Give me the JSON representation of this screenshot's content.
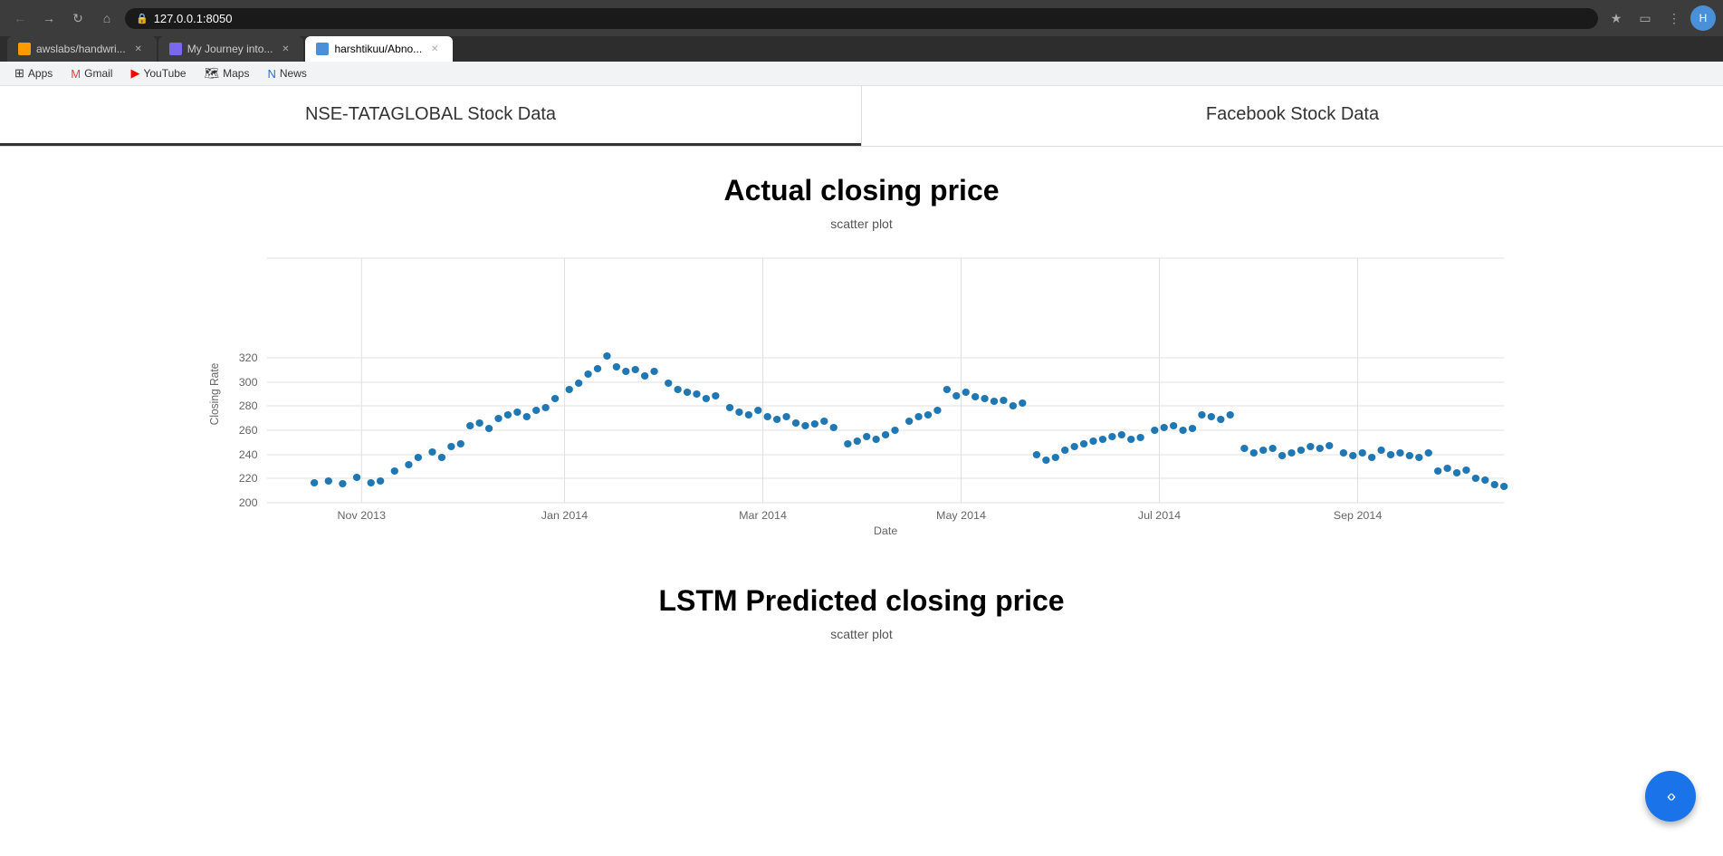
{
  "browser": {
    "url": "127.0.0.1:8050",
    "back_disabled": false,
    "forward_disabled": false
  },
  "tabs": [
    {
      "id": "awslabs",
      "title": "awslabs/handwri...",
      "favicon_color": "#ff9900",
      "active": false
    },
    {
      "id": "myjourney",
      "title": "My Journey into...",
      "favicon_color": "#7b68ee",
      "active": false
    },
    {
      "id": "harshtikuu",
      "title": "harshtikuu/Abno...",
      "favicon_color": "#4a90d9",
      "active": true
    }
  ],
  "bookmarks": [
    {
      "id": "apps",
      "label": "Apps",
      "favicon": "grid"
    },
    {
      "id": "gmail",
      "label": "Gmail",
      "favicon": "gmail"
    },
    {
      "id": "youtube",
      "label": "YouTube",
      "favicon": "youtube"
    },
    {
      "id": "maps",
      "label": "Maps",
      "favicon": "maps"
    },
    {
      "id": "news",
      "label": "News",
      "favicon": "news"
    }
  ],
  "page": {
    "nav_items": [
      {
        "id": "nse",
        "label": "NSE-TATAGLOBAL Stock Data",
        "active": true
      },
      {
        "id": "facebook",
        "label": "Facebook Stock Data",
        "active": false
      }
    ],
    "actual_chart": {
      "title": "Actual closing price",
      "subtitle": "scatter plot",
      "y_axis_label": "Closing Rate",
      "x_axis_label": "Date",
      "y_ticks": [
        200,
        220,
        240,
        260,
        280,
        300,
        320
      ],
      "x_ticks": [
        "Nov 2013",
        "Jan 2014",
        "Mar 2014",
        "May 2014",
        "Jul 2014",
        "Sep 2014"
      ]
    },
    "lstm_chart": {
      "title": "LSTM Predicted closing price",
      "subtitle": "scatter plot"
    }
  },
  "fab": {
    "label": "‹›"
  }
}
